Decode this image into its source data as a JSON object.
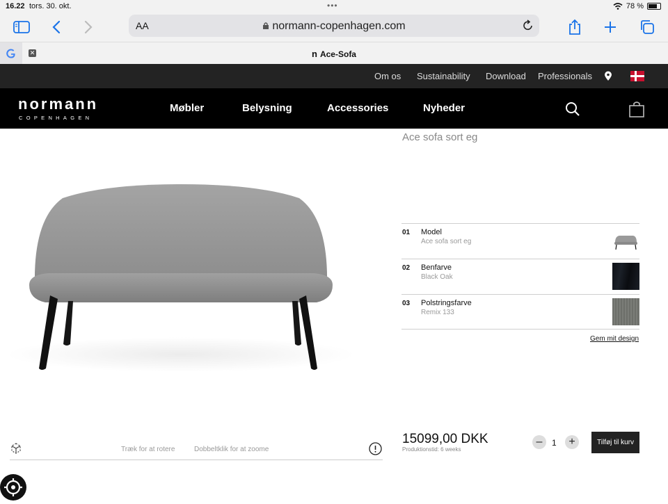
{
  "status": {
    "time": "16.22",
    "date": "tors. 30. okt.",
    "battery_percent": "78 %"
  },
  "browser": {
    "text_size": "AA",
    "url": "normann-copenhagen.com",
    "tab_title": "Ace-Sofa"
  },
  "util_nav": [
    "Om os",
    "Sustainability",
    "Download",
    "Professionals"
  ],
  "brand": {
    "name": "normann",
    "sub": "COPENHAGEN"
  },
  "main_nav": [
    "Møbler",
    "Belysning",
    "Accessories",
    "Nyheder"
  ],
  "product": {
    "name": "Ace sofa sort eg",
    "config": [
      {
        "num": "01",
        "label": "Model",
        "value": "Ace sofa sort eg"
      },
      {
        "num": "02",
        "label": "Benfarve",
        "value": "Black Oak"
      },
      {
        "num": "03",
        "label": "Polstringsfarve",
        "value": "Remix 133"
      }
    ],
    "save_design": "Gem mit design",
    "price": "15099,00 DKK",
    "production_time": "Produktionstid: 6 weeks",
    "quantity": "1",
    "add_to_cart": "Tilføj til kurv",
    "hint_rotate": "Træk for at rotere",
    "hint_zoom": "Dobbeltklik for at zoome"
  },
  "colors": {
    "nav_bg": "#000000",
    "util_bg": "#232323",
    "sofa": "#8f8f8f",
    "legs": "#111111",
    "link_blue": "#1a73e8"
  }
}
